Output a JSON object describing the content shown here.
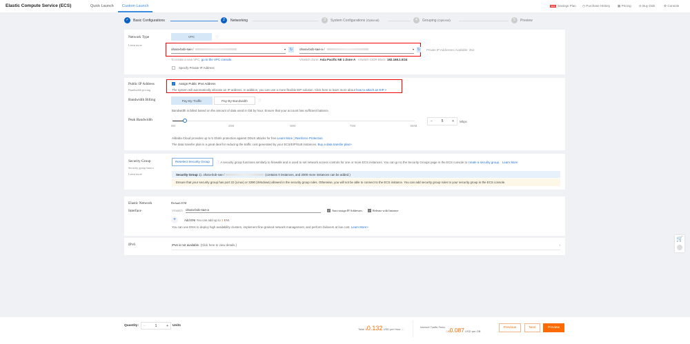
{
  "header": {
    "title": "Elastic Compute Service (ECS)",
    "tabs": [
      "Quick Launch",
      "Custom Launch"
    ],
    "links": {
      "savings_badge": "NEW",
      "savings": "Savings Plan",
      "purchase_history": "Purchase History",
      "pricing": "Pricing",
      "buy_disk": "Buy Disk",
      "console": "Console"
    }
  },
  "steps": [
    {
      "num": "✓",
      "label": "Basic Configurations"
    },
    {
      "num": "2",
      "label": "Networking"
    },
    {
      "num": "3",
      "label": "System Configurations",
      "opt": "(Optional)"
    },
    {
      "num": "4",
      "label": "Grouping",
      "opt": "(Optional)"
    },
    {
      "num": "5",
      "label": "Preview"
    }
  ],
  "network": {
    "label": "Network Type",
    "learn": "Learn more",
    "type_btn": "VPC",
    "vpc_value": "ohara-bob-sae /",
    "vswitch_value": "ohara-bob-sae-a /",
    "ip_available": "Private IP Addresses Available: 252.",
    "create_vpc": "To create a new VPC,",
    "vpc_console": "go to the VPC console.",
    "zone_label": "VSwitch Zone:",
    "zone": "Asia Pacific NE 1 Zone A",
    "cidr_label": "VSwitch CIDR Block:",
    "cidr": "192.168.1.0/24",
    "specify_ip": "Specify Private IP Address"
  },
  "public_ip": {
    "label": "Public IP Address",
    "sub": "Bandwidth pricing",
    "assign": "Assign Public IPv4 Address",
    "desc": "The system will automatically allocate an IP address. In addition, you can use a more flexible EIP solution. Click here to learn more about",
    "eip_link": "how to attach an EIP >",
    "billing_label": "Bandwidth Billing",
    "pay_traffic": "Pay-By-Traffic",
    "pay_bandwidth": "Pay-By-Bandwidth",
    "billing_desc": "Bandwidth is billed based on the amount of data used in GB by hour. Ensure that your account has sufficient balance.",
    "peak_label": "Peak Bandwidth",
    "ticks": [
      "0M",
      "25M",
      "50M",
      "75M",
      "100M"
    ],
    "peak_value": "5",
    "peak_fraction": 0.05,
    "unit": "Mbps",
    "ddos": "Alibaba Cloud provides up to 5 Gbit/s protection against DDoS attacks for free.",
    "ddos_learn": "Learn More",
    "ddos_sep": "|",
    "ddos_reinforce": "Reinforce Protection",
    "plan": "The data transfer plan is a great deal for reducing the traffic cost generated by your ECS/EIP/SLB instances.",
    "plan_link": "Buy a data transfer plan>"
  },
  "security": {
    "label": "Security Group",
    "basics": "Security group basics",
    "learn": "Learn more",
    "reselect": "Reselect Security Group",
    "desc": "A security group functions similarly to firewalls and is used to set network access controls for one or more ECS instances. You can go to the Security Groups page in the ECS console to",
    "create_link": "create a security group.",
    "learn_more": "Learn More",
    "sg_title": "Security Group",
    "sg_value": "1). ohara-bob-sae /",
    "sg_info": "(contains 0 instances, and 2000 more instances can be added.)",
    "warning": "Ensure that your security group has port 22 (Linux) or 3390 (Windows) allowed in the security group rules. Otherwise, you will not be able to connect to the ECS instance. You can add security group rules to your security group in the ECS console."
  },
  "eni": {
    "label1": "Elastic Network",
    "label2": "Interface",
    "default": "Default ENI",
    "vswitch_label": "VSwitch",
    "vswitch": "ohara-bob-sae-a",
    "auto_assign": "Auto-assign IP Addresses",
    "release": "Release with Instance",
    "add": "Add ENI",
    "add_desc": "You can add up to",
    "add_count": "1",
    "add_unit": "ENI.",
    "desc": "You can use ENIs to deploy high availability clusters, implement fine-grained network management, and perform failovers at low cost.",
    "learn": "Learn More>"
  },
  "ipv6": {
    "label": "IPv6",
    "text": "IPv6 is not available.",
    "link": "(Click here to view details.)"
  },
  "footer": {
    "quantity_label": "Quantity:",
    "quantity": "1",
    "units": "Units",
    "total_label": "Total:",
    "currency": "$",
    "total": "0.132",
    "total_unit": "USD per Hour",
    "traffic_label": "Internet Traffic Fees:",
    "traffic": "0.087",
    "traffic_unit": "USD per GB",
    "previous": "Previous",
    "next": "Next",
    "preview": "Preview"
  },
  "colors": {
    "accent": "#1f6fd1",
    "orange": "#ff6a00",
    "highlight": "#e00000"
  }
}
